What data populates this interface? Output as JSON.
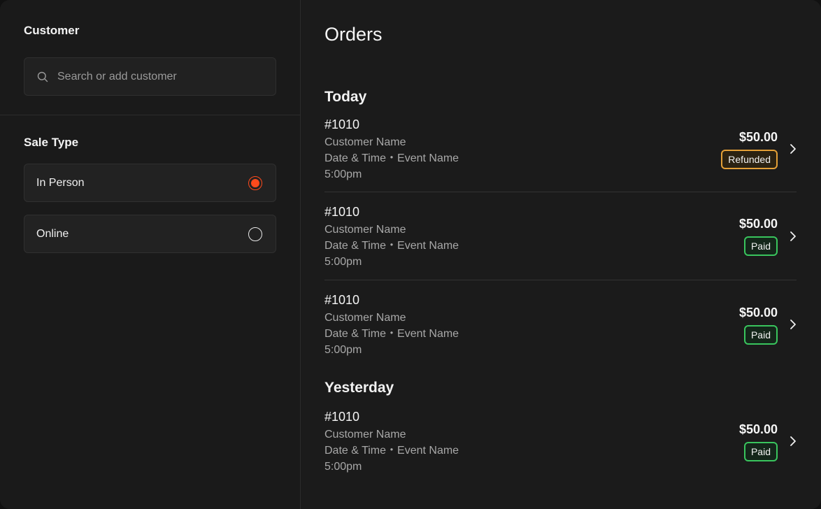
{
  "customer": {
    "title": "Customer",
    "search_placeholder": "Search or add customer"
  },
  "sale_type": {
    "title": "Sale Type",
    "options": [
      {
        "label": "In Person",
        "selected": true
      },
      {
        "label": "Online",
        "selected": false
      }
    ]
  },
  "orders": {
    "title": "Orders",
    "groups": [
      {
        "label": "Today",
        "items": [
          {
            "id": "#1010",
            "customer": "Customer Name",
            "event": "Date & Time・Event Name",
            "time": "5:00pm",
            "amount": "$50.00",
            "status": "Refunded"
          },
          {
            "id": "#1010",
            "customer": "Customer Name",
            "event": "Date & Time・Event Name",
            "time": "5:00pm",
            "amount": "$50.00",
            "status": "Paid"
          },
          {
            "id": "#1010",
            "customer": "Customer Name",
            "event": "Date & Time・Event Name",
            "time": "5:00pm",
            "amount": "$50.00",
            "status": "Paid"
          }
        ]
      },
      {
        "label": "Yesterday",
        "items": [
          {
            "id": "#1010",
            "customer": "Customer Name",
            "event": "Date & Time・Event Name",
            "time": "5:00pm",
            "amount": "$50.00",
            "status": "Paid"
          }
        ]
      }
    ]
  },
  "colors": {
    "accent": "#ff4a1c",
    "refunded": "#e4a037",
    "paid": "#39c55d"
  },
  "icons": {
    "search": "search-icon",
    "chevron": "chevron-right-icon"
  }
}
